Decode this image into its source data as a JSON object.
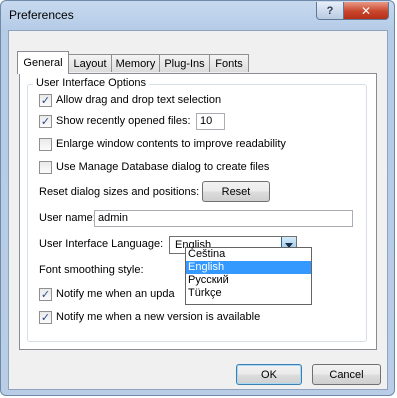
{
  "window": {
    "title": "Preferences",
    "help_glyph": "?",
    "close_glyph": "✕"
  },
  "tabs": [
    {
      "label": "General"
    },
    {
      "label": "Layout"
    },
    {
      "label": "Memory"
    },
    {
      "label": "Plug-Ins"
    },
    {
      "label": "Fonts"
    }
  ],
  "group": {
    "title": "User Interface Options"
  },
  "options": {
    "allow_drag_drop": {
      "label": "Allow drag and drop text selection",
      "checked": true
    },
    "show_recent": {
      "label": "Show recently opened files:",
      "checked": true,
      "value": "10"
    },
    "enlarge_window": {
      "label": "Enlarge window contents to improve readability",
      "checked": false
    },
    "manage_db": {
      "label": "Use Manage Database dialog to create files",
      "checked": false
    }
  },
  "reset": {
    "label": "Reset dialog sizes and positions:",
    "button": "Reset"
  },
  "user_name": {
    "label": "User name:",
    "value": "admin"
  },
  "language": {
    "label": "User Interface Language:",
    "selected": "English",
    "options": [
      "Čeština",
      "English",
      "Русский",
      "Türkçe"
    ],
    "highlighted_index": 1
  },
  "font_smoothing": {
    "label": "Font smoothing style:"
  },
  "notify_update": {
    "label": "Notify me when an upda",
    "checked": true
  },
  "notify_version": {
    "label": "Notify me when a new version is available",
    "checked": true
  },
  "footer": {
    "ok": "OK",
    "cancel": "Cancel"
  },
  "check_glyph": "✓",
  "icons": {
    "dropdown_arrow": "chevron-down-icon"
  }
}
